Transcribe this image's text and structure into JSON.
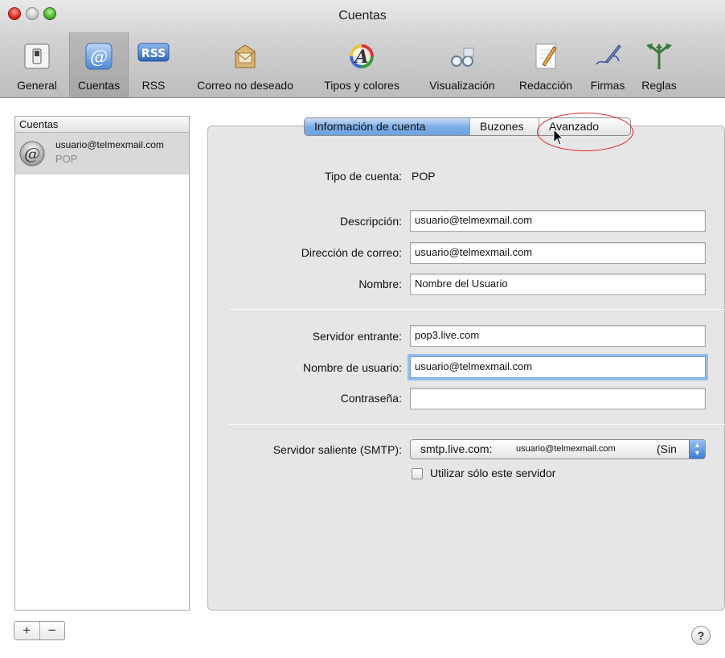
{
  "window": {
    "title": "Cuentas"
  },
  "toolbar": {
    "items": [
      {
        "label": "General",
        "icon": "general-switch-icon"
      },
      {
        "label": "Cuentas",
        "icon": "at-sign-icon",
        "selected": true
      },
      {
        "label": "RSS",
        "icon": "rss-icon"
      },
      {
        "label": "Correo no deseado",
        "icon": "junk-mail-icon"
      },
      {
        "label": "Tipos y colores",
        "icon": "font-colors-icon"
      },
      {
        "label": "Visualización",
        "icon": "glasses-icon"
      },
      {
        "label": "Redacción",
        "icon": "notepad-pencil-icon"
      },
      {
        "label": "Firmas",
        "icon": "signature-pen-icon"
      },
      {
        "label": "Reglas",
        "icon": "rules-arrows-icon"
      }
    ]
  },
  "sidebar": {
    "header": "Cuentas",
    "accounts": [
      {
        "name": "usuario@telmexmail.com",
        "type": "POP"
      }
    ],
    "add_label": "+",
    "remove_label": "−"
  },
  "tabs": [
    {
      "label": "Información de cuenta",
      "active": true
    },
    {
      "label": "Buzones",
      "active": false
    },
    {
      "label": "Avanzado",
      "active": false
    }
  ],
  "form": {
    "account_type_label": "Tipo de cuenta:",
    "account_type_value": "POP",
    "description_label": "Descripción:",
    "description_value": "usuario@telmexmail.com",
    "email_label": "Dirección de correo:",
    "email_value": "usuario@telmexmail.com",
    "name_label": "Nombre:",
    "name_value": "Nombre del Usuario",
    "incoming_label": "Servidor entrante:",
    "incoming_value": "pop3.live.com",
    "username_label": "Nombre de usuario:",
    "username_value": "usuario@telmexmail.com",
    "password_label": "Contraseña:",
    "password_value": "",
    "smtp_label": "Servidor saliente (SMTP):",
    "smtp_server": "smtp.live.com:",
    "smtp_user": "usuario@telmexmail.com",
    "smtp_suffix": "(Sin",
    "only_this_server_label": "Utilizar sólo este servidor",
    "only_this_server_checked": false
  },
  "help_label": "?"
}
